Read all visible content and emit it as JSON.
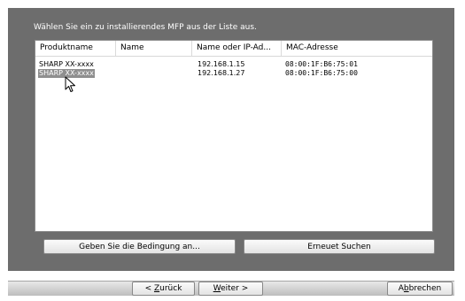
{
  "prompt": "Wählen Sie ein zu installierendes MFP aus der Liste aus.",
  "list": {
    "columns": [
      "Produktname",
      "Name",
      "Name oder IP-Ad...",
      "MAC-Adresse"
    ],
    "rows": [
      {
        "product": "SHARP  XX-xxxx",
        "name": "",
        "ip": "192.168.1.15",
        "mac": "08:00:1F:B6:75:01",
        "selected": false
      },
      {
        "product": "SHARP  XX-xxxx",
        "name": "",
        "ip": "192.168.1.27",
        "mac": "08:00:1F:B6:75:00",
        "selected": true
      }
    ]
  },
  "buttons": {
    "condition": "Geben Sie die Bedingung an...",
    "search_again": "Erneuet Suchen"
  },
  "footer": {
    "back_prefix": "< ",
    "back_key": "Z",
    "back_rest": "urück",
    "next_key": "W",
    "next_rest": "eiter >",
    "cancel_pre": "A",
    "cancel_key": "b",
    "cancel_rest": "brechen"
  },
  "colors": {
    "panel": "#6d6d6d",
    "selection": "#8f8f8f"
  },
  "icons": [
    "mouse-pointer-icon"
  ]
}
